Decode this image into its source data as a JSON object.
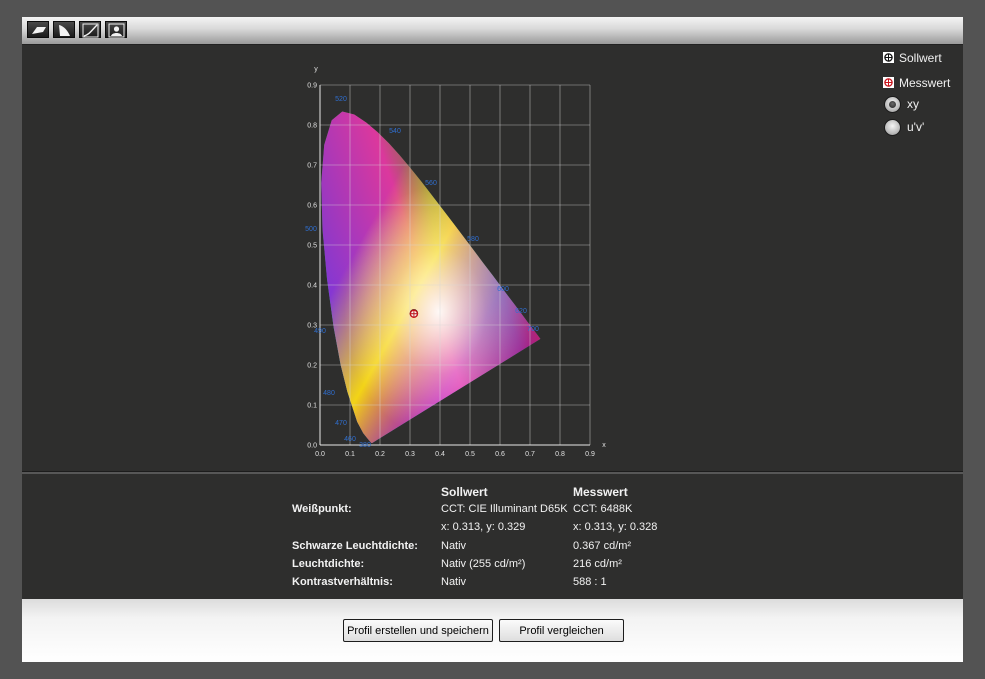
{
  "toolbar": {
    "buttons": [
      {
        "icon": "gamut-view-icon"
      },
      {
        "icon": "white-point-icon"
      },
      {
        "icon": "tone-curve-icon"
      },
      {
        "icon": "user-icon"
      }
    ]
  },
  "legend": {
    "target_label": "Sollwert",
    "measured_label": "Messwert",
    "options": [
      {
        "label": "xy",
        "checked": true
      },
      {
        "label": "u'v'",
        "checked": false
      }
    ]
  },
  "chart_data": {
    "type": "scatter",
    "xlabel": "x",
    "ylabel": "y",
    "xlim": [
      0.0,
      0.9
    ],
    "ylim": [
      0.0,
      0.9
    ],
    "x_ticks": [
      "0.0",
      "0.1",
      "0.2",
      "0.3",
      "0.4",
      "0.5",
      "0.6",
      "0.7",
      "0.8",
      "0.9"
    ],
    "y_ticks": [
      "0.0",
      "0.1",
      "0.2",
      "0.3",
      "0.4",
      "0.5",
      "0.6",
      "0.7",
      "0.8",
      "0.9"
    ],
    "grid": true,
    "wavelength_labels": [
      {
        "text": "520",
        "x": 0.07,
        "y": 0.86
      },
      {
        "text": "540",
        "x": 0.25,
        "y": 0.78
      },
      {
        "text": "560",
        "x": 0.37,
        "y": 0.65
      },
      {
        "text": "580",
        "x": 0.51,
        "y": 0.51
      },
      {
        "text": "600",
        "x": 0.61,
        "y": 0.385
      },
      {
        "text": "620",
        "x": 0.67,
        "y": 0.33
      },
      {
        "text": "700",
        "x": 0.71,
        "y": 0.285
      },
      {
        "text": "500",
        "x": -0.03,
        "y": 0.535
      },
      {
        "text": "490",
        "x": 0.0,
        "y": 0.28
      },
      {
        "text": "480",
        "x": 0.03,
        "y": 0.125
      },
      {
        "text": "470",
        "x": 0.07,
        "y": 0.05
      },
      {
        "text": "460",
        "x": 0.1,
        "y": 0.01
      },
      {
        "text": "380",
        "x": 0.15,
        "y": -0.005
      }
    ],
    "points": [
      {
        "name": "Sollwert",
        "x": 0.313,
        "y": 0.329
      },
      {
        "name": "Messwert",
        "x": 0.313,
        "y": 0.328
      }
    ]
  },
  "info": {
    "col_target": "Sollwert",
    "col_measured": "Messwert",
    "rows": [
      {
        "label": "Weißpunkt:",
        "target": "CCT: CIE Illuminant D65K",
        "measured": "CCT: 6488K"
      },
      {
        "label": "",
        "target": "x: 0.313, y: 0.329",
        "measured": "x: 0.313, y: 0.328"
      },
      {
        "label": "Schwarze Leuchtdichte:",
        "target": "Nativ",
        "measured": "0.367 cd/m²"
      },
      {
        "label": "Leuchtdichte:",
        "target": "Nativ (255 cd/m²)",
        "measured": "216 cd/m²"
      },
      {
        "label": "Kontrastverhältnis:",
        "target": "Nativ",
        "measured": "588 : 1"
      }
    ]
  },
  "footer": {
    "create_button": "Profil erstellen und speichern",
    "compare_button": "Profil vergleichen"
  },
  "colors": {
    "background": "#535353",
    "panel": "#2e2e2d",
    "wavelength_label": "#2f6fd1",
    "marker": "#c8141c"
  }
}
